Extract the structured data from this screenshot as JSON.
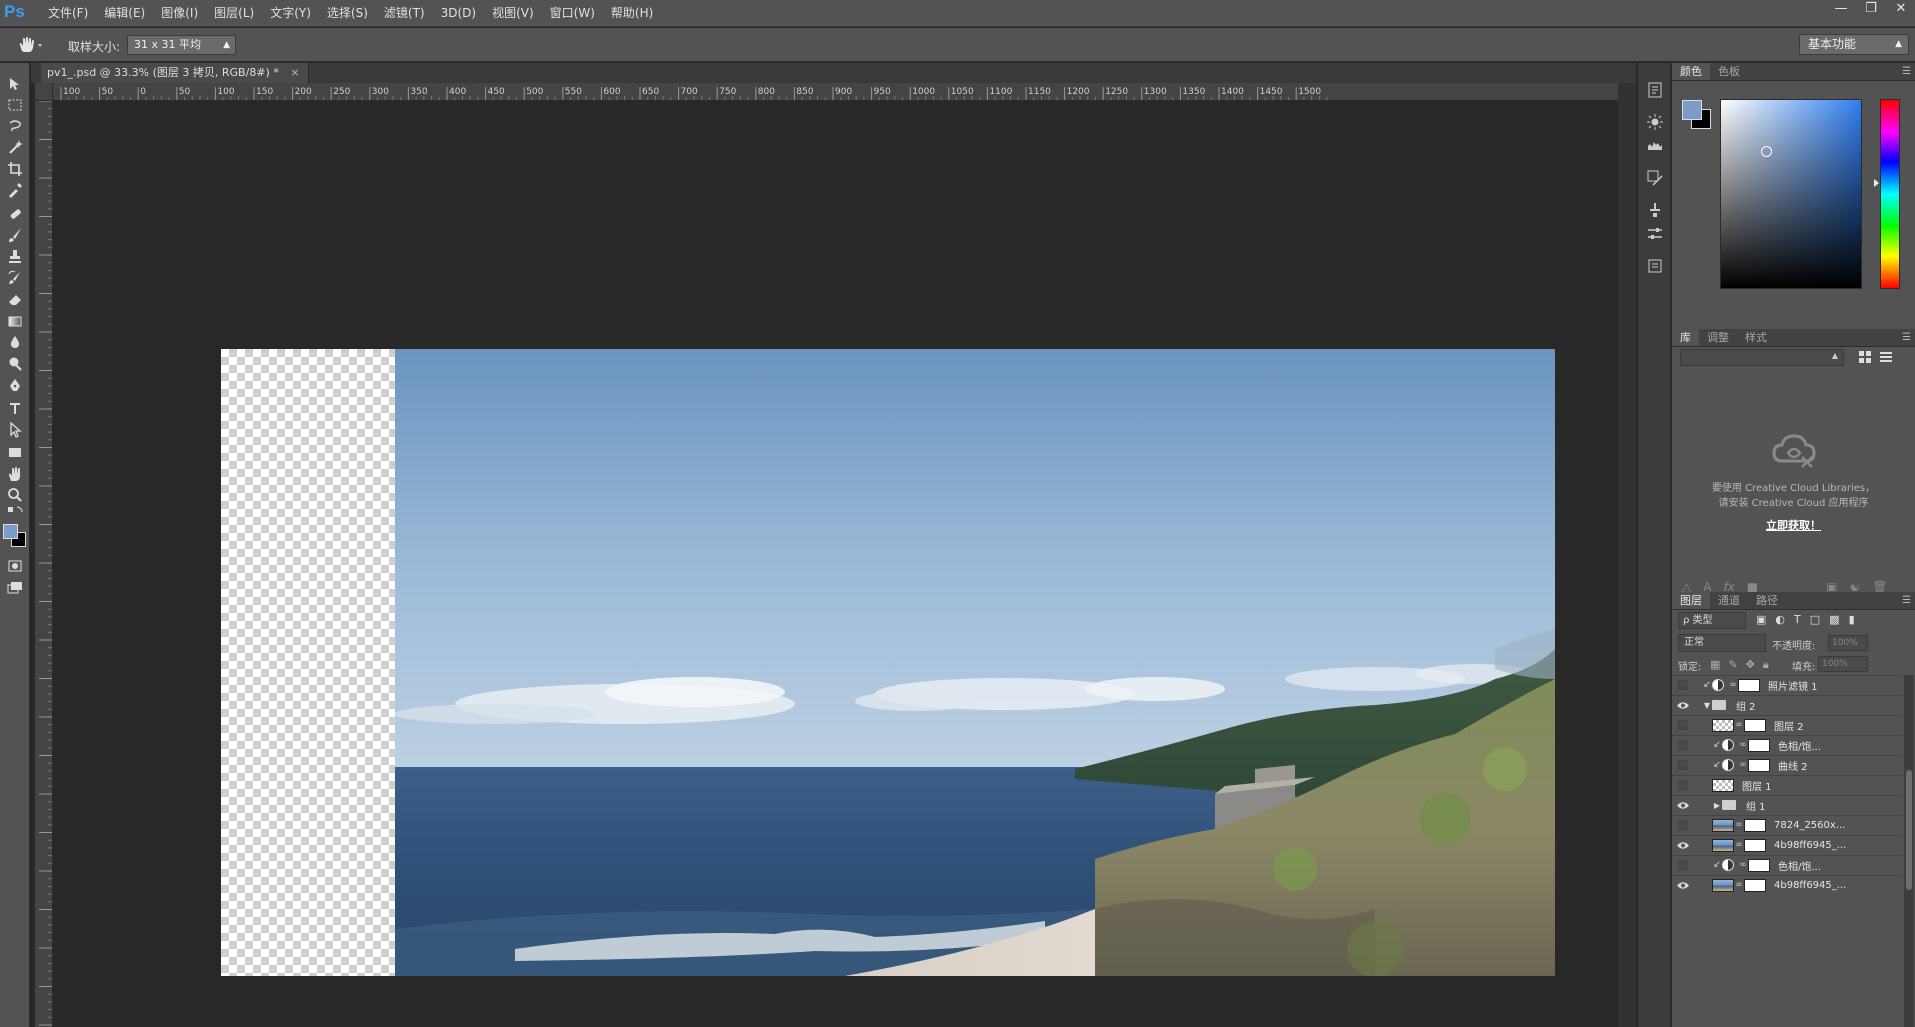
{
  "app": {
    "logo": "Ps",
    "menus": [
      "文件(F)",
      "编辑(E)",
      "图像(I)",
      "图层(L)",
      "文字(Y)",
      "选择(S)",
      "滤镜(T)",
      "3D(D)",
      "视图(V)",
      "窗口(W)",
      "帮助(H)"
    ],
    "window_controls": [
      "minimize-icon",
      "restore-icon",
      "close-icon"
    ]
  },
  "options": {
    "tool_icon": "hand-icon",
    "sample_label": "取样大小:",
    "sample_value": "31 x 31 平均",
    "workspace": "基本功能"
  },
  "document": {
    "tab_title": "pv1_.psd @ 33.3% (图层 3 拷贝, RGB/8#) *",
    "close_symbol": "×",
    "ruler_h_labels": [
      "100",
      "50",
      "0",
      "50",
      "100",
      "150",
      "200",
      "250",
      "300",
      "350",
      "400",
      "450",
      "500",
      "550",
      "600",
      "650",
      "700",
      "750",
      "800",
      "850",
      "900",
      "950",
      "1000",
      "1050",
      "1100",
      "1150",
      "1200",
      "1250",
      "1300",
      "1350",
      "1400",
      "1450",
      "1500"
    ]
  },
  "tools": [
    "move-icon",
    "marquee-icon",
    "lasso-icon",
    "magic-wand-icon",
    "crop-icon",
    "eyedropper-icon",
    "healing-brush-icon",
    "brush-icon",
    "clone-stamp-icon",
    "history-brush-icon",
    "eraser-icon",
    "gradient-icon",
    "blur-icon",
    "dodge-icon",
    "pen-icon",
    "type-icon",
    "path-select-icon",
    "shape-icon",
    "hand-icon",
    "zoom-icon"
  ],
  "colors": {
    "foreground": "#7b9bc8",
    "background": "#000000",
    "accent": "#3aa0f0"
  },
  "color_panel": {
    "tabs": [
      "颜色",
      "色板"
    ]
  },
  "library_panel": {
    "tabs": [
      "库",
      "调整",
      "样式"
    ],
    "message_line1": "要使用 Creative Cloud Libraries，",
    "message_line2": "请安装 Creative Cloud 应用程序",
    "link": "立即获取！"
  },
  "layers_panel": {
    "tabs": [
      "图层",
      "通道",
      "路径"
    ],
    "filter": "ρ 类型",
    "blend_mode": "正常",
    "opacity_label": "不透明度:",
    "opacity_value": "100%",
    "lock_label": "锁定:",
    "fill_label": "填充:",
    "fill_value": "100%",
    "layers": [
      {
        "name": "照片滤镜 1",
        "visible": false,
        "kind": "adjustment",
        "clipped": true,
        "indent": 0
      },
      {
        "name": "组 2",
        "visible": true,
        "kind": "group-open",
        "indent": 0
      },
      {
        "name": "图层 2",
        "visible": false,
        "kind": "pixel-mask",
        "indent": 1
      },
      {
        "name": "色相/饱...",
        "visible": false,
        "kind": "adjustment",
        "clipped": true,
        "indent": 1
      },
      {
        "name": "曲线 2",
        "visible": false,
        "kind": "adjustment",
        "clipped": true,
        "indent": 1
      },
      {
        "name": "图层 1",
        "visible": false,
        "kind": "pixel",
        "indent": 1
      },
      {
        "name": "组 1",
        "visible": true,
        "kind": "group-closed",
        "indent": 1
      },
      {
        "name": "7824_2560x...",
        "visible": false,
        "kind": "photo-mask",
        "indent": 1
      },
      {
        "name": "4b98ff6945_...",
        "visible": true,
        "kind": "photo-mask",
        "indent": 1
      },
      {
        "name": "色相/饱...",
        "visible": false,
        "kind": "adjustment",
        "clipped": true,
        "indent": 1
      },
      {
        "name": "4b98ff6945_...",
        "visible": true,
        "kind": "photo-mask",
        "indent": 1
      }
    ]
  }
}
